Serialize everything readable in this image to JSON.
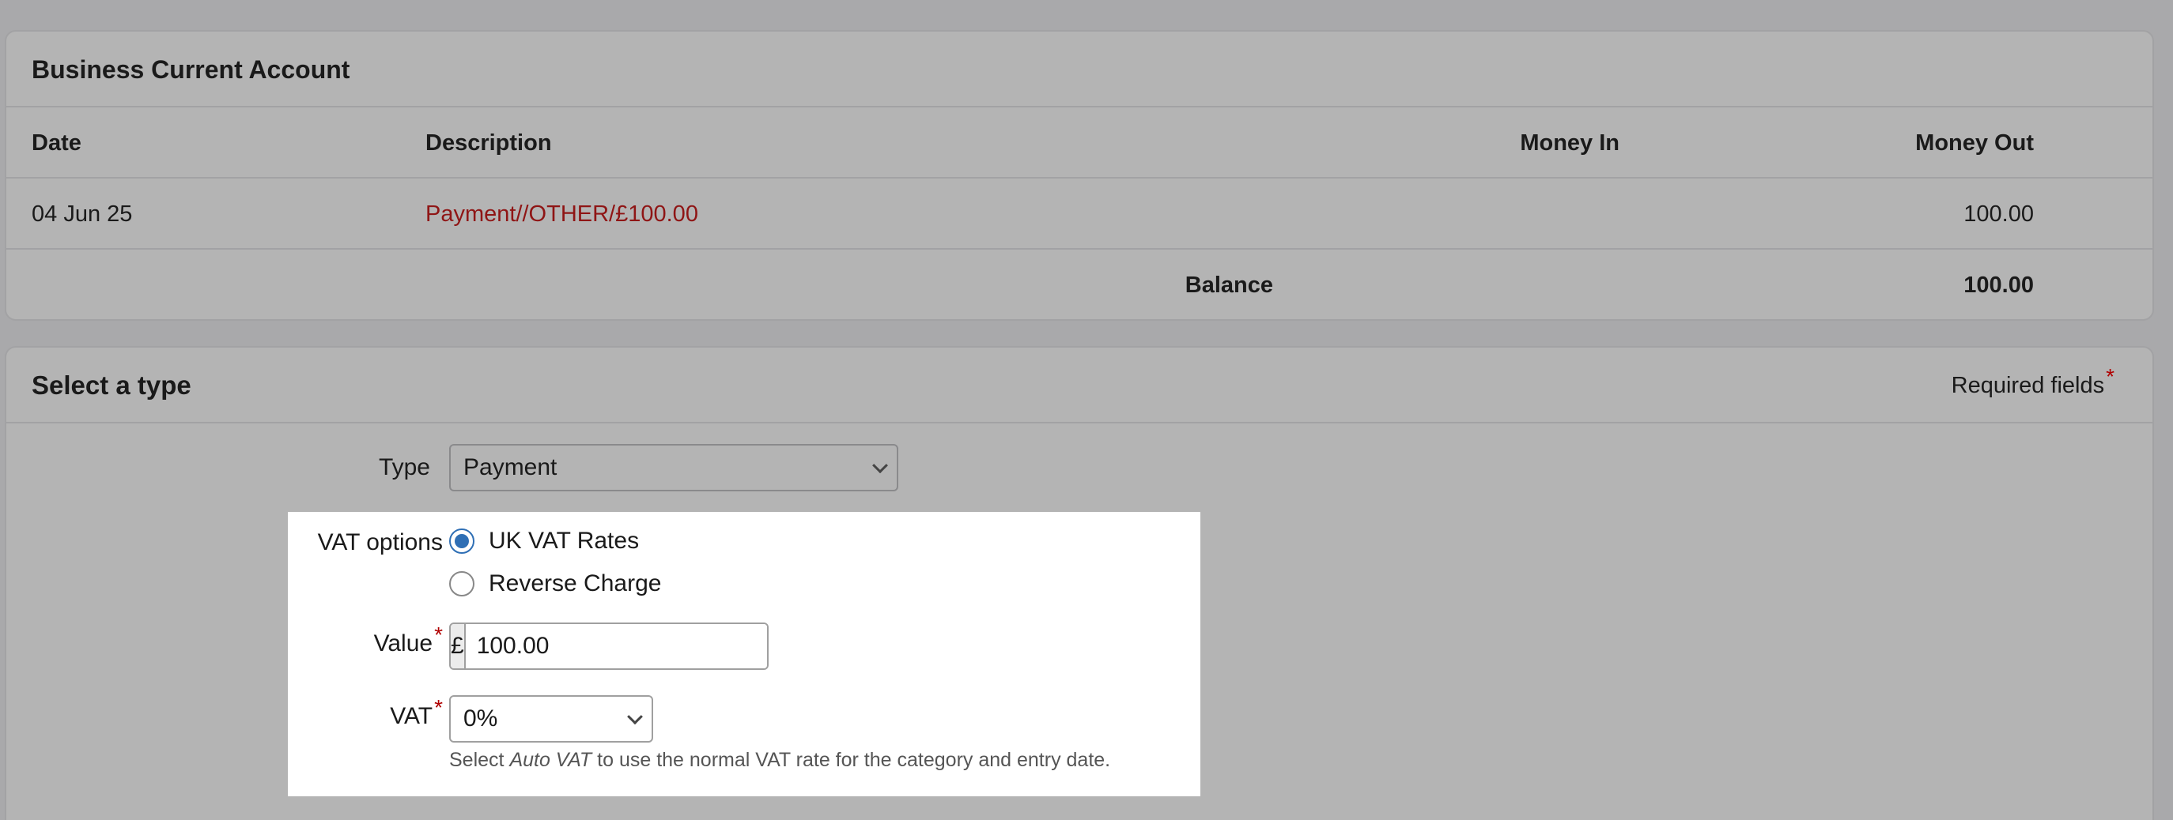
{
  "account": {
    "title": "Business Current Account",
    "columns": {
      "date": "Date",
      "description": "Description",
      "money_in": "Money In",
      "money_out": "Money Out"
    },
    "transactions": [
      {
        "date": "04 Jun 25",
        "description": "Payment//OTHER/£100.00",
        "money_in": "",
        "money_out": "100.00"
      }
    ],
    "balance_label": "Balance",
    "balance_value": "100.00"
  },
  "type_form": {
    "title": "Select a type",
    "required_note": "Required fields",
    "required_marker": "*",
    "type_label": "Type",
    "type_value": "Payment",
    "vat_options_label": "VAT options",
    "vat_options": [
      {
        "label": "UK VAT Rates",
        "checked": true
      },
      {
        "label": "Reverse Charge",
        "checked": false
      }
    ],
    "value_label": "Value",
    "currency_symbol": "£",
    "value": "100.00",
    "vat_label": "VAT",
    "vat_value": "0%",
    "vat_help_prefix": "Select ",
    "vat_help_em": "Auto VAT",
    "vat_help_suffix": " to use the normal VAT rate for the category and entry date."
  },
  "colors": {
    "link_red": "#8f1515",
    "radio_blue": "#2f6fb5",
    "required_star": "#b00000"
  }
}
